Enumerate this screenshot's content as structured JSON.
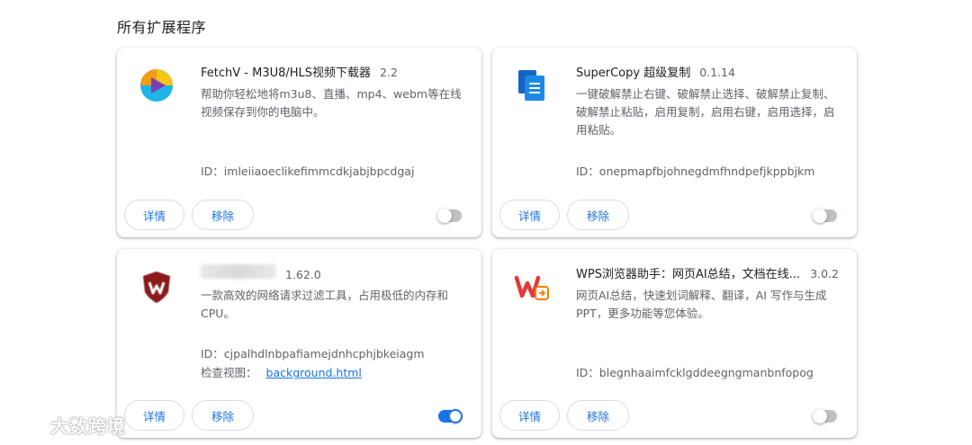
{
  "section_title": "所有扩展程序",
  "extensions": [
    {
      "name": "FetchV - M3U8/HLS视频下载器",
      "version": "2.2",
      "description": "帮助你轻松地将m3u8、直播、mp4、webm等在线视频保存到你的电脑中。",
      "id_line": "ID：imleiiaoeclikefimmcdkjabjbpcdgaj",
      "icon": "fetchv-play-icon",
      "enabled": false
    },
    {
      "name": "SuperCopy 超级复制",
      "version": "0.1.14",
      "description": "一键破解禁止右键、破解禁止选择、破解禁止复制、破解禁止粘贴，启用复制，启用右键，启用选择，启用粘贴。",
      "id_line": "ID：onepmapfbjohnegdmfhndpefjkppbjkm",
      "icon": "copy-document-icon",
      "enabled": false
    },
    {
      "name": "",
      "version": "1.62.0",
      "description": "一款高效的网络请求过滤工具，占用极低的内存和CPU。",
      "id_line": "ID：cjpalhdlnbpafiamejdnhcphjbkeiagm",
      "inspect_label": "检查视图：",
      "inspect_link": "background.html",
      "icon": "shield-blocker-icon",
      "enabled": true
    },
    {
      "name": "WPS浏览器助手：网页AI总结，文档在线...",
      "version": "3.0.2",
      "description": "网页AI总结，快速划词解释、翻译，AI 写作与生成PPT，更多功能等您体验。",
      "id_line": "ID：blegnhaaimfcklgddeegngmanbnfopog",
      "icon": "wps-logo-icon",
      "enabled": false
    }
  ],
  "buttons": {
    "details": "详情",
    "remove": "移除"
  },
  "watermark": "大数跨境",
  "colors": {
    "accent": "#1a73e8",
    "toggle_off": "#bdc1c6"
  }
}
